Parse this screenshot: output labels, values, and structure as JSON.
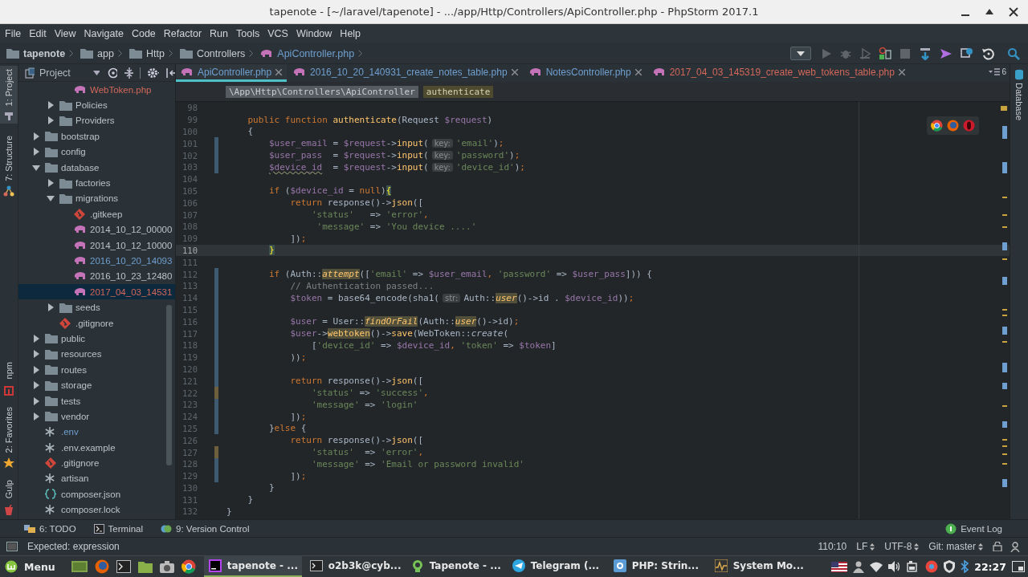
{
  "window": {
    "title": "tapenote - [~/laravel/tapenote] - .../app/Http/Controllers/ApiController.php - PhpStorm 2017.1"
  },
  "menu": [
    "File",
    "Edit",
    "View",
    "Navigate",
    "Code",
    "Refactor",
    "Run",
    "Tools",
    "VCS",
    "Window",
    "Help"
  ],
  "navigation_bar": [
    {
      "label": "tapenote",
      "kind": "project"
    },
    {
      "label": "app",
      "kind": "folder"
    },
    {
      "label": "Http",
      "kind": "folder"
    },
    {
      "label": "Controllers",
      "kind": "folder"
    },
    {
      "label": "ApiController.php",
      "kind": "php"
    }
  ],
  "left_tool_tabs": [
    {
      "label": "1: Project",
      "selected": true,
      "kind": "project"
    },
    {
      "label": "7: Structure",
      "selected": false,
      "kind": "structure"
    },
    {
      "label": "npm",
      "selected": false,
      "kind": "npm"
    },
    {
      "label": "2: Favorites",
      "selected": false,
      "kind": "favorites"
    },
    {
      "label": "Gulp",
      "selected": false,
      "kind": "gulp"
    }
  ],
  "right_tool_tabs": [
    {
      "label": "Database",
      "selected": false
    }
  ],
  "project_panel": {
    "title": "Project",
    "tree": [
      {
        "children": [
          {
            "children": [
              {
                "label": "WebToken.php",
                "kind": "php",
                "color": "#d2675a",
                "selected": false
              }
            ]
          },
          {
            "label": "Policies",
            "kind": "folder",
            "expanded": false,
            "selected": false
          },
          {
            "label": "Providers",
            "kind": "folder",
            "expanded": false,
            "selected": false
          }
        ]
      },
      {
        "label": "bootstrap",
        "kind": "folder",
        "expanded": false,
        "selected": false
      },
      {
        "label": "config",
        "kind": "folder",
        "expanded": false,
        "selected": false
      },
      {
        "label": "database",
        "kind": "folder",
        "expanded": true,
        "selected": false,
        "children": [
          {
            "label": "factories",
            "kind": "folder",
            "expanded": false,
            "selected": false
          },
          {
            "label": "migrations",
            "kind": "folder",
            "expanded": true,
            "selected": false,
            "children": [
              {
                "label": ".gitkeep",
                "kind": "git",
                "selected": false
              },
              {
                "label": "2014_10_12_00000",
                "kind": "php",
                "selected": false
              },
              {
                "label": "2014_10_12_10000",
                "kind": "php",
                "selected": false
              },
              {
                "label": "2016_10_20_14093",
                "kind": "php",
                "color": "#6f9fd0",
                "selected": false
              },
              {
                "label": "2016_10_23_12480",
                "kind": "php",
                "selected": false
              },
              {
                "label": "2017_04_03_14531",
                "kind": "php",
                "color": "#d2675a",
                "selected": true
              }
            ]
          },
          {
            "label": "seeds",
            "kind": "folder",
            "expanded": false,
            "selected": false
          },
          {
            "label": ".gitignore",
            "kind": "git",
            "selected": false
          }
        ]
      },
      {
        "label": "public",
        "kind": "folder",
        "expanded": false,
        "selected": false
      },
      {
        "label": "resources",
        "kind": "folder",
        "expanded": false,
        "selected": false
      },
      {
        "label": "routes",
        "kind": "folder",
        "expanded": false,
        "selected": false
      },
      {
        "label": "storage",
        "kind": "folder",
        "expanded": false,
        "selected": false
      },
      {
        "label": "tests",
        "kind": "folder",
        "expanded": false,
        "selected": false
      },
      {
        "label": "vendor",
        "kind": "folder",
        "expanded": false,
        "selected": false
      },
      {
        "label": ".env",
        "kind": "file",
        "color": "#6f9fd0",
        "selected": false
      },
      {
        "label": ".env.example",
        "kind": "file",
        "selected": false
      },
      {
        "label": ".gitignore",
        "kind": "git",
        "selected": false
      },
      {
        "label": "artisan",
        "kind": "file",
        "selected": false
      },
      {
        "label": "composer.json",
        "kind": "json",
        "selected": false
      },
      {
        "label": "composer.lock",
        "kind": "file",
        "selected": false
      }
    ]
  },
  "editor": {
    "tabs": [
      {
        "label": "ApiController.php",
        "selected": true,
        "color": "#6f9fd0"
      },
      {
        "label": "2016_10_20_140931_create_notes_table.php",
        "selected": false,
        "color": "#6f9fd0"
      },
      {
        "label": "NotesController.php",
        "selected": false,
        "color": "#6f9fd0"
      },
      {
        "label": "2017_04_03_145319_create_web_tokens_table.php",
        "selected": false,
        "color": "#d2675a"
      }
    ],
    "hidden_tabs_count": "6",
    "breadcrumbs": [
      {
        "label": "\\App\\Http\\Controllers\\ApiController",
        "kind": "class"
      },
      {
        "label": "authenticate",
        "kind": "method"
      }
    ],
    "lines": [
      {
        "number": "98",
        "current": false
      },
      {
        "number": "99",
        "current": false,
        "tokens": [
          {
            "kind": "keyword",
            "text": "    public function "
          },
          {
            "kind": "method",
            "text": "authenticate"
          },
          {
            "kind": "plain",
            "text": "(Request "
          },
          {
            "kind": "variable",
            "text": "$request"
          },
          {
            "kind": "plain",
            "text": ")"
          }
        ]
      },
      {
        "number": "100",
        "current": false,
        "tokens": [
          {
            "kind": "plain",
            "text": "    {"
          }
        ]
      },
      {
        "number": "101",
        "current": false,
        "color": "#3d5a70",
        "tokens": [
          {
            "kind": "variable",
            "text": "        $user_email"
          },
          {
            "kind": "plain",
            "text": " = "
          },
          {
            "kind": "variable",
            "text": "$request"
          },
          {
            "kind": "plain",
            "text": "->"
          },
          {
            "kind": "method",
            "text": "input"
          },
          {
            "kind": "plain",
            "text": "("
          },
          {
            "kind": "hint",
            "text": "key:"
          },
          {
            "kind": "string",
            "text": "'email'"
          },
          {
            "kind": "plain",
            "text": ")"
          },
          {
            "kind": "keyword",
            "text": ";"
          }
        ]
      },
      {
        "number": "102",
        "current": false,
        "color": "#3d5a70",
        "tokens": [
          {
            "kind": "variable",
            "text": "        $user_pass"
          },
          {
            "kind": "plain",
            "text": "  = "
          },
          {
            "kind": "variable",
            "text": "$request"
          },
          {
            "kind": "plain",
            "text": "->"
          },
          {
            "kind": "method",
            "text": "input"
          },
          {
            "kind": "plain",
            "text": "("
          },
          {
            "kind": "hint",
            "text": "key:"
          },
          {
            "kind": "string",
            "text": "'password'"
          },
          {
            "kind": "plain",
            "text": ")"
          },
          {
            "kind": "keyword",
            "text": ";"
          }
        ]
      },
      {
        "number": "103",
        "current": false,
        "color": "#3d5a70",
        "tokens": [
          {
            "kind": "warning",
            "text": "        $device_id"
          },
          {
            "kind": "plain",
            "text": "  = "
          },
          {
            "kind": "variable",
            "text": "$request"
          },
          {
            "kind": "plain",
            "text": "->"
          },
          {
            "kind": "method",
            "text": "input"
          },
          {
            "kind": "plain",
            "text": "("
          },
          {
            "kind": "hint",
            "text": "key:"
          },
          {
            "kind": "string",
            "text": "'device_id'"
          },
          {
            "kind": "plain",
            "text": ")"
          },
          {
            "kind": "keyword",
            "text": ";"
          }
        ]
      },
      {
        "number": "104",
        "current": false
      },
      {
        "number": "105",
        "current": false,
        "tokens": [
          {
            "kind": "keyword",
            "text": "        if "
          },
          {
            "kind": "plain",
            "text": "("
          },
          {
            "kind": "variable",
            "text": "$device_id"
          },
          {
            "kind": "plain",
            "text": " = "
          },
          {
            "kind": "keyword",
            "text": "null"
          },
          {
            "kind": "plain",
            "text": ")"
          },
          {
            "kind": "brace",
            "text": "{"
          }
        ]
      },
      {
        "number": "106",
        "current": false,
        "tokens": [
          {
            "kind": "keyword",
            "text": "            return "
          },
          {
            "kind": "plain",
            "text": "response()->"
          },
          {
            "kind": "method",
            "text": "json"
          },
          {
            "kind": "plain",
            "text": "(["
          }
        ]
      },
      {
        "number": "107",
        "current": false,
        "tokens": [
          {
            "kind": "string",
            "text": "                'status'"
          },
          {
            "kind": "plain",
            "text": "   => "
          },
          {
            "kind": "string",
            "text": "'error'"
          },
          {
            "kind": "keyword",
            "text": ","
          }
        ]
      },
      {
        "number": "108",
        "current": false,
        "tokens": [
          {
            "kind": "string",
            "text": "                 'message'"
          },
          {
            "kind": "plain",
            "text": " => "
          },
          {
            "kind": "string",
            "text": "'You device ....'"
          }
        ]
      },
      {
        "number": "109",
        "current": false,
        "tokens": [
          {
            "kind": "plain",
            "text": "            ])"
          },
          {
            "kind": "keyword",
            "text": ";"
          }
        ]
      },
      {
        "number": "110",
        "current": true,
        "tokens": [
          {
            "kind": "brace",
            "text": "        }"
          }
        ]
      },
      {
        "number": "111",
        "current": false
      },
      {
        "number": "112",
        "current": false,
        "color": "#3d5a70",
        "tokens": [
          {
            "kind": "keyword",
            "text": "        if "
          },
          {
            "kind": "plain",
            "text": "(Auth::"
          },
          {
            "kind": "usage",
            "text": "attempt"
          },
          {
            "kind": "plain",
            "text": "(["
          },
          {
            "kind": "string",
            "text": "'email'"
          },
          {
            "kind": "plain",
            "text": " => "
          },
          {
            "kind": "variable",
            "text": "$user_email"
          },
          {
            "kind": "keyword",
            "text": ", "
          },
          {
            "kind": "string",
            "text": "'password'"
          },
          {
            "kind": "plain",
            "text": " => "
          },
          {
            "kind": "variable",
            "text": "$user_pass"
          },
          {
            "kind": "plain",
            "text": "])) {"
          }
        ]
      },
      {
        "number": "113",
        "current": false,
        "color": "#3d5a70",
        "tokens": [
          {
            "kind": "comment",
            "text": "            // Authentication passed..."
          }
        ]
      },
      {
        "number": "114",
        "current": false,
        "color": "#3d5a70",
        "tokens": [
          {
            "kind": "variable",
            "text": "            $token"
          },
          {
            "kind": "plain",
            "text": " = base64_encode(sha1("
          },
          {
            "kind": "hint",
            "text": "str:"
          },
          {
            "kind": "plain",
            "text": "Auth::"
          },
          {
            "kind": "usage",
            "text": "user"
          },
          {
            "kind": "plain",
            "text": "()->id . "
          },
          {
            "kind": "variable",
            "text": "$device_id"
          },
          {
            "kind": "plain",
            "text": "))"
          },
          {
            "kind": "keyword",
            "text": ";"
          }
        ]
      },
      {
        "number": "115",
        "current": false,
        "color": "#3d5a70"
      },
      {
        "number": "116",
        "current": false,
        "color": "#3d5a70",
        "tokens": [
          {
            "kind": "variable",
            "text": "            $user"
          },
          {
            "kind": "plain",
            "text": " = User::"
          },
          {
            "kind": "usage",
            "text": "findOrFail"
          },
          {
            "kind": "plain",
            "text": "(Auth::"
          },
          {
            "kind": "usage",
            "text": "user"
          },
          {
            "kind": "plain",
            "text": "()->id)"
          },
          {
            "kind": "keyword",
            "text": ";"
          }
        ]
      },
      {
        "number": "117",
        "current": false,
        "color": "#3d5a70",
        "tokens": [
          {
            "kind": "variable",
            "text": "            $user"
          },
          {
            "kind": "plain",
            "text": "->"
          },
          {
            "kind": "highlight",
            "text": "webtoken"
          },
          {
            "kind": "plain",
            "text": "()->"
          },
          {
            "kind": "method",
            "text": "save"
          },
          {
            "kind": "plain",
            "text": "(WebToken::"
          },
          {
            "kind": "static",
            "text": "create"
          },
          {
            "kind": "plain",
            "text": "("
          }
        ]
      },
      {
        "number": "118",
        "current": false,
        "color": "#3d5a70",
        "tokens": [
          {
            "kind": "plain",
            "text": "                ["
          },
          {
            "kind": "string",
            "text": "'device_id'"
          },
          {
            "kind": "plain",
            "text": " => "
          },
          {
            "kind": "variable",
            "text": "$device_id"
          },
          {
            "kind": "keyword",
            "text": ", "
          },
          {
            "kind": "string",
            "text": "'token'"
          },
          {
            "kind": "plain",
            "text": " => "
          },
          {
            "kind": "variable",
            "text": "$token"
          },
          {
            "kind": "plain",
            "text": "]"
          }
        ]
      },
      {
        "number": "119",
        "current": false,
        "color": "#3d5a70",
        "tokens": [
          {
            "kind": "plain",
            "text": "            ))"
          },
          {
            "kind": "keyword",
            "text": ";"
          }
        ]
      },
      {
        "number": "120",
        "current": false,
        "color": "#3d5a70"
      },
      {
        "number": "121",
        "current": false,
        "color": "#3d5a70",
        "tokens": [
          {
            "kind": "keyword",
            "text": "            return "
          },
          {
            "kind": "plain",
            "text": "response()->"
          },
          {
            "kind": "method",
            "text": "json"
          },
          {
            "kind": "plain",
            "text": "(["
          }
        ]
      },
      {
        "number": "122",
        "current": false,
        "color": "#6e5f3c",
        "tokens": [
          {
            "kind": "string",
            "text": "                'status'"
          },
          {
            "kind": "plain",
            "text": " => "
          },
          {
            "kind": "string",
            "text": "'success'"
          },
          {
            "kind": "keyword",
            "text": ","
          }
        ]
      },
      {
        "number": "123",
        "current": false,
        "color": "#3d5a70",
        "tokens": [
          {
            "kind": "string",
            "text": "                'message'"
          },
          {
            "kind": "plain",
            "text": " => "
          },
          {
            "kind": "string",
            "text": "'login'"
          }
        ]
      },
      {
        "number": "124",
        "current": false,
        "color": "#3d5a70",
        "tokens": [
          {
            "kind": "plain",
            "text": "            ])"
          },
          {
            "kind": "keyword",
            "text": ";"
          }
        ]
      },
      {
        "number": "125",
        "current": false,
        "color": "#3d5a70",
        "tokens": [
          {
            "kind": "plain",
            "text": "        }"
          },
          {
            "kind": "keyword",
            "text": "else "
          },
          {
            "kind": "plain",
            "text": "{"
          }
        ]
      },
      {
        "number": "126",
        "current": false,
        "tokens": [
          {
            "kind": "keyword",
            "text": "            return "
          },
          {
            "kind": "plain",
            "text": "response()->"
          },
          {
            "kind": "method",
            "text": "json"
          },
          {
            "kind": "plain",
            "text": "(["
          }
        ]
      },
      {
        "number": "127",
        "current": false,
        "color": "#6e5f3c",
        "tokens": [
          {
            "kind": "string",
            "text": "                'status'"
          },
          {
            "kind": "plain",
            "text": "  => "
          },
          {
            "kind": "string",
            "text": "'error'"
          },
          {
            "kind": "keyword",
            "text": ","
          }
        ]
      },
      {
        "number": "128",
        "current": false,
        "color": "#3d5a70",
        "tokens": [
          {
            "kind": "string",
            "text": "                'message'"
          },
          {
            "kind": "plain",
            "text": " => "
          },
          {
            "kind": "string",
            "text": "'Email or password invalid'"
          }
        ]
      },
      {
        "number": "129",
        "current": false,
        "color": "#3d5a70",
        "tokens": [
          {
            "kind": "plain",
            "text": "            ])"
          },
          {
            "kind": "keyword",
            "text": ";"
          }
        ]
      },
      {
        "number": "130",
        "current": false,
        "tokens": [
          {
            "kind": "plain",
            "text": "        }"
          }
        ]
      },
      {
        "number": "131",
        "current": false,
        "tokens": [
          {
            "kind": "plain",
            "text": "    }"
          }
        ]
      },
      {
        "number": "132",
        "current": false,
        "tokens": [
          {
            "kind": "plain",
            "text": "}"
          }
        ]
      }
    ]
  },
  "tool_windows": [
    {
      "label": "6: TODO",
      "kind": "todo"
    },
    {
      "label": "Terminal",
      "kind": "terminal"
    },
    {
      "label": "9: Version Control",
      "kind": "vcs"
    },
    {
      "label": "Event Log",
      "kind": "event-log"
    }
  ],
  "status_bar": {
    "message": "Expected: expression",
    "position": "110:10",
    "line_separator": "LF",
    "encoding": "UTF-8",
    "vcs_branch": "Git: master"
  },
  "taskbar": {
    "menu": "Menu",
    "windows": [
      {
        "title": "tapenote - ...",
        "kind": "phpstorm",
        "selected": true
      },
      {
        "title": "o2b3k@cyb...",
        "kind": "terminal",
        "selected": false
      },
      {
        "title": "Tapenote - ...",
        "kind": "android",
        "selected": false
      },
      {
        "title": "Telegram (...",
        "kind": "telegram",
        "selected": false
      },
      {
        "title": "PHP: Strin...",
        "kind": "browser",
        "selected": false
      },
      {
        "title": "System Mo...",
        "kind": "monitor",
        "selected": false
      }
    ],
    "clock": "22:27"
  }
}
